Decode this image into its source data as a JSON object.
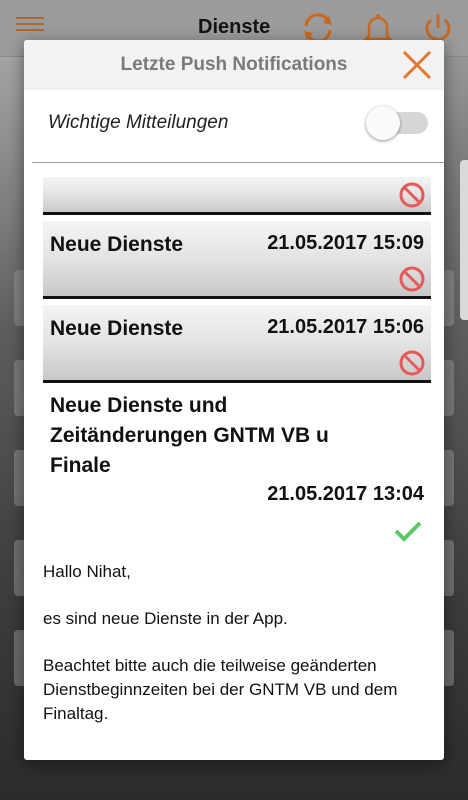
{
  "app": {
    "title": "Dienste",
    "icons": [
      "menu-icon",
      "refresh-icon",
      "bell-icon",
      "power-icon"
    ],
    "accent_color": "#c8691f"
  },
  "dialog": {
    "title": "Letzte Push Notifications",
    "close_icon": "close-icon",
    "toggle": {
      "label": "Wichtige Mitteilungen",
      "on": false
    },
    "notifications": [
      {
        "title": "",
        "date": "",
        "status_icon": "block-icon"
      },
      {
        "title": "Neue Dienste",
        "date": "21.05.2017 15:09",
        "status_icon": "block-icon"
      },
      {
        "title": "Neue Dienste",
        "date": "21.05.2017 15:06",
        "status_icon": "block-icon"
      }
    ],
    "expanded": {
      "title": "Neue Dienste und Zeitänderungen GNTM VB u Finale",
      "date": "21.05.2017 13:04",
      "status_icon": "check-icon",
      "body": [
        "Hallo Nihat,",
        "es sind neue Dienste in der App.",
        "Beachtet bitte auch die teilweise geänderten Dienstbeginnzeiten bei der GNTM VB und dem Finaltag."
      ]
    },
    "colors": {
      "block": "#e35a5a",
      "check": "#5bc86a"
    }
  }
}
